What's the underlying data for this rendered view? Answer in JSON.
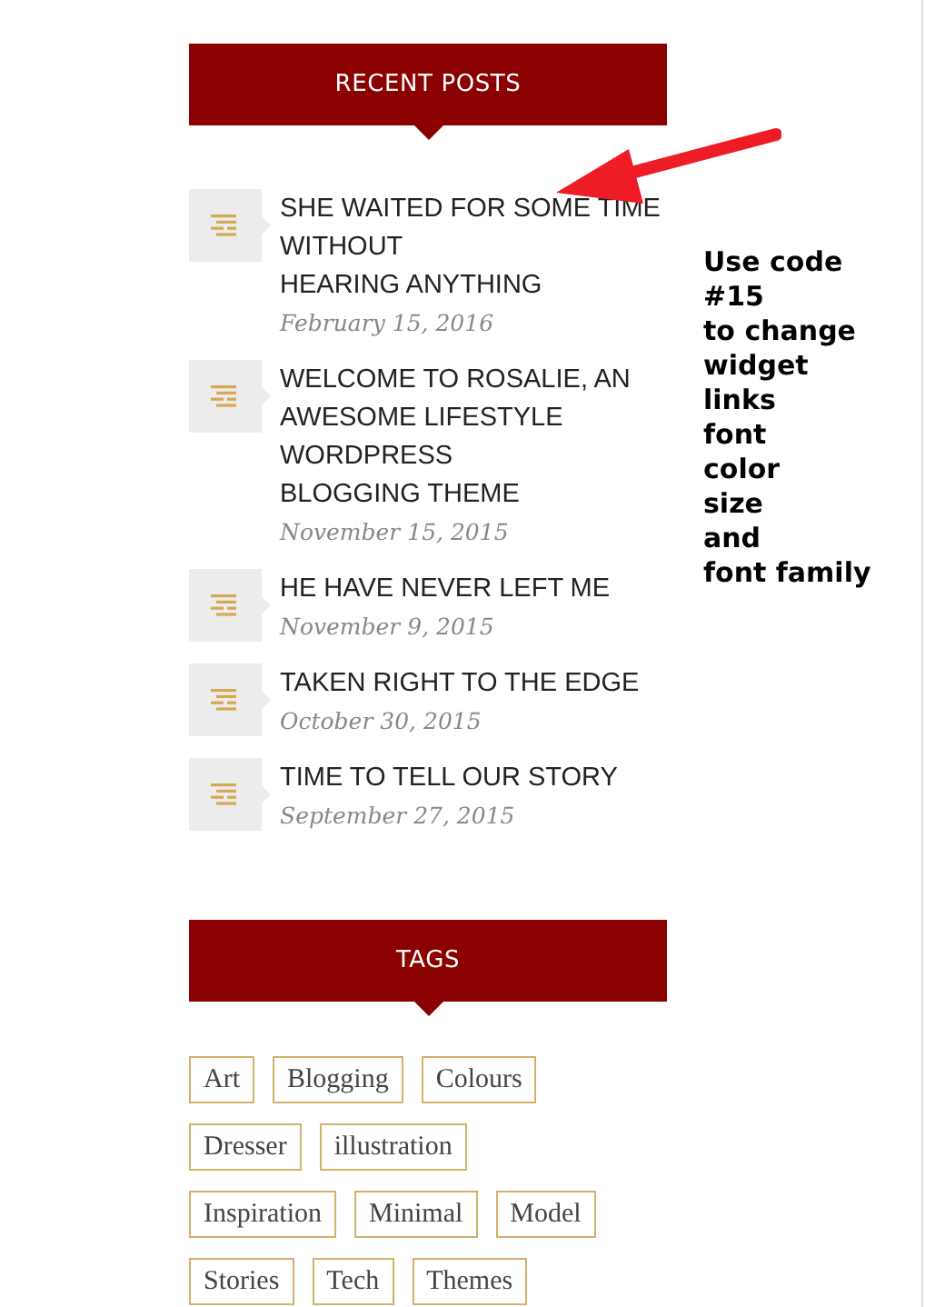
{
  "recent_posts": {
    "title": "RECENT POSTS",
    "posts": [
      {
        "title": "SHE WAITED FOR SOME TIME WITHOUT\nHEARING ANYTHING",
        "date": "February 15, 2016"
      },
      {
        "title": "WELCOME TO ROSALIE, AN AWESOME LIFESTYLE WORDPRESS\nBLOGGING THEME",
        "date": "November 15, 2015"
      },
      {
        "title": "HE HAVE NEVER LEFT ME",
        "date": "November 9, 2015"
      },
      {
        "title": "TAKEN RIGHT TO THE EDGE",
        "date": "October 30, 2015"
      },
      {
        "title": "TIME TO TELL OUR STORY",
        "date": "September 27, 2015"
      }
    ]
  },
  "annotation": {
    "text": "Use code\n#15\nto change\nwidget\nlinks\nfont\ncolor\nsize\nand\nfont family"
  },
  "tags": {
    "title": "TAGS",
    "items": [
      [
        "Art",
        "Blogging",
        "Colours"
      ],
      [
        "Dresser",
        "illustration"
      ],
      [
        "Inspiration",
        "Minimal",
        "Model"
      ],
      [
        "Stories",
        "Tech",
        "Themes"
      ]
    ]
  }
}
